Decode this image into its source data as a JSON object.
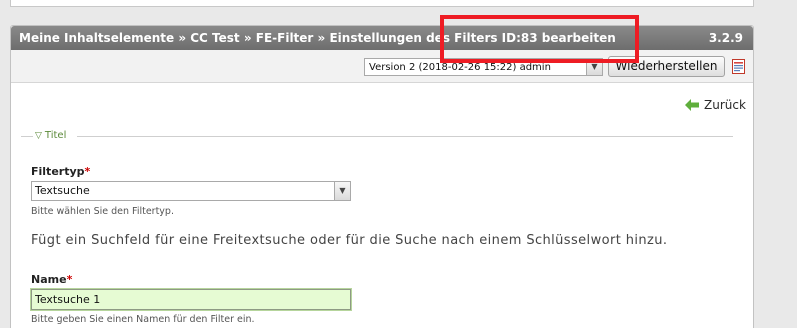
{
  "header": {
    "breadcrumb": "Meine Inhaltselemente » CC Test » FE-Filter » Einstellungen des Filters ID:83 bearbeiten",
    "version": "3.2.9"
  },
  "toolbar": {
    "version_select_value": "Version 2 (2018-02-26 15:22) admin",
    "restore_label": "Wiederherstellen"
  },
  "back_link": {
    "label": "Zurück"
  },
  "fieldset": {
    "legend": "Titel"
  },
  "filtertype": {
    "label": "Filtertyp",
    "required_mark": "*",
    "value": "Textsuche",
    "hint": "Bitte wählen Sie den Filtertyp.",
    "description": "Fügt ein Suchfeld für eine Freitextsuche oder für die Suche nach einem Schlüsselwort hinzu."
  },
  "name": {
    "label": "Name",
    "required_mark": "*",
    "value": "Textsuche 1",
    "hint": "Bitte geben Sie einen Namen für den Filter ein."
  },
  "colors": {
    "header_bg": "#7a7a7a",
    "input_focus_bg": "#e6fbd3",
    "legend_color": "#5c8a3a",
    "required_color": "#cc0000",
    "annotation_red": "#ee1c24"
  },
  "icons": {
    "back": "arrow-left-green-icon",
    "document": "document-red-icon",
    "dropdown": "chevron-down-icon",
    "legend_toggle": "triangle-down-icon"
  }
}
